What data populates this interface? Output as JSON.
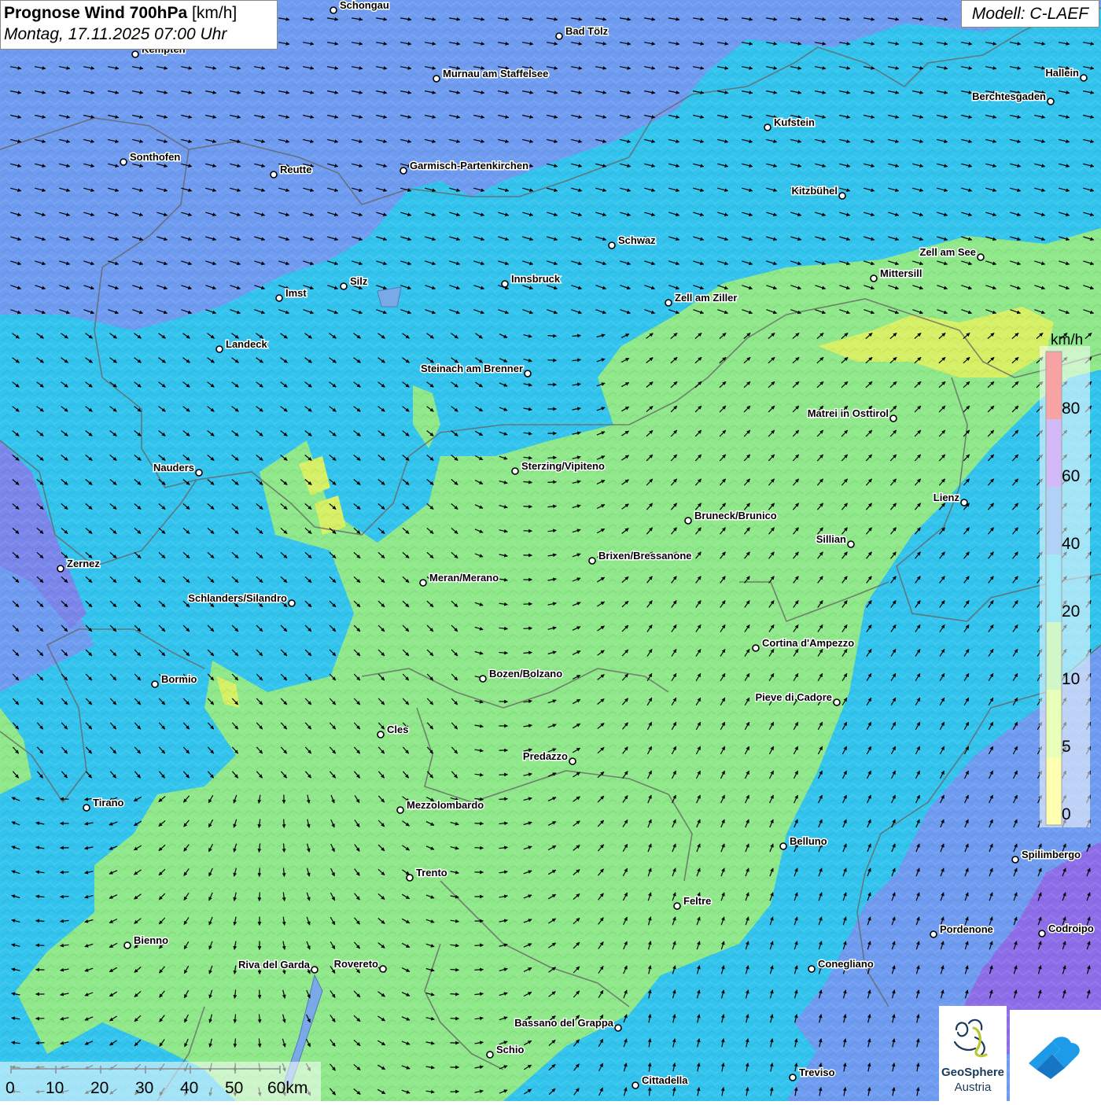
{
  "header": {
    "title_bold": "Prognose Wind 700hPa",
    "title_unit": "[km/h]",
    "datetime": "Montag, 17.11.2025 07:00 Uhr"
  },
  "model_label": "Modell: C-LAEF",
  "legend": {
    "unit": "km/h",
    "ticks": [
      "0",
      "5",
      "10",
      "20",
      "40",
      "60",
      "80"
    ],
    "colors": [
      "#ffff55",
      "#ccff66",
      "#99ee88",
      "#33ccee",
      "#5599ee",
      "#9966ee",
      "#ee3333"
    ]
  },
  "scalebar": {
    "ticks": [
      "0",
      "10",
      "20",
      "30",
      "40",
      "50",
      "60km"
    ]
  },
  "logo": {
    "name": "GeoSphere",
    "subtitle": "Austria"
  },
  "cities": [
    {
      "name": "Schongau"
    },
    {
      "name": "Bad Tölz"
    },
    {
      "name": "Kempten"
    },
    {
      "name": "Murnau am Staffelsee"
    },
    {
      "name": "Hallein"
    },
    {
      "name": "Berchtesgaden"
    },
    {
      "name": "Kufstein"
    },
    {
      "name": "Sonthofen"
    },
    {
      "name": "Reutte"
    },
    {
      "name": "Garmisch-Partenkirchen"
    },
    {
      "name": "Kitzbühel"
    },
    {
      "name": "Schwaz"
    },
    {
      "name": "Zell am See"
    },
    {
      "name": "Silz"
    },
    {
      "name": "Innsbruck"
    },
    {
      "name": "Imst"
    },
    {
      "name": "Mittersill"
    },
    {
      "name": "Zell am Ziller"
    },
    {
      "name": "Landeck"
    },
    {
      "name": "Steinach am Brenner"
    },
    {
      "name": "Matrei in Osttirol"
    },
    {
      "name": "Nauders"
    },
    {
      "name": "Sterzing/Vipiteno"
    },
    {
      "name": "Lienz"
    },
    {
      "name": "Bruneck/Brunico"
    },
    {
      "name": "Sillian"
    },
    {
      "name": "Zernez"
    },
    {
      "name": "Brixen/Bressanone"
    },
    {
      "name": "Meran/Merano"
    },
    {
      "name": "Schlanders/Silandro"
    },
    {
      "name": "Cortina d'Ampezzo"
    },
    {
      "name": "Bozen/Bolzano"
    },
    {
      "name": "Bormio"
    },
    {
      "name": "Pieve di Cadore"
    },
    {
      "name": "Cles"
    },
    {
      "name": "Predazzo"
    },
    {
      "name": "Tirano"
    },
    {
      "name": "Mezzolombardo"
    },
    {
      "name": "Belluno"
    },
    {
      "name": "Spilimbergo"
    },
    {
      "name": "Trento"
    },
    {
      "name": "Feltre"
    },
    {
      "name": "Bienno"
    },
    {
      "name": "Pordenone"
    },
    {
      "name": "Codroipo"
    },
    {
      "name": "Riva del Garda"
    },
    {
      "name": "Rovereto"
    },
    {
      "name": "Conegliano"
    },
    {
      "name": "Bassano del Grappa"
    },
    {
      "name": "Schio"
    },
    {
      "name": "Treviso"
    },
    {
      "name": "Cittadella"
    }
  ]
}
